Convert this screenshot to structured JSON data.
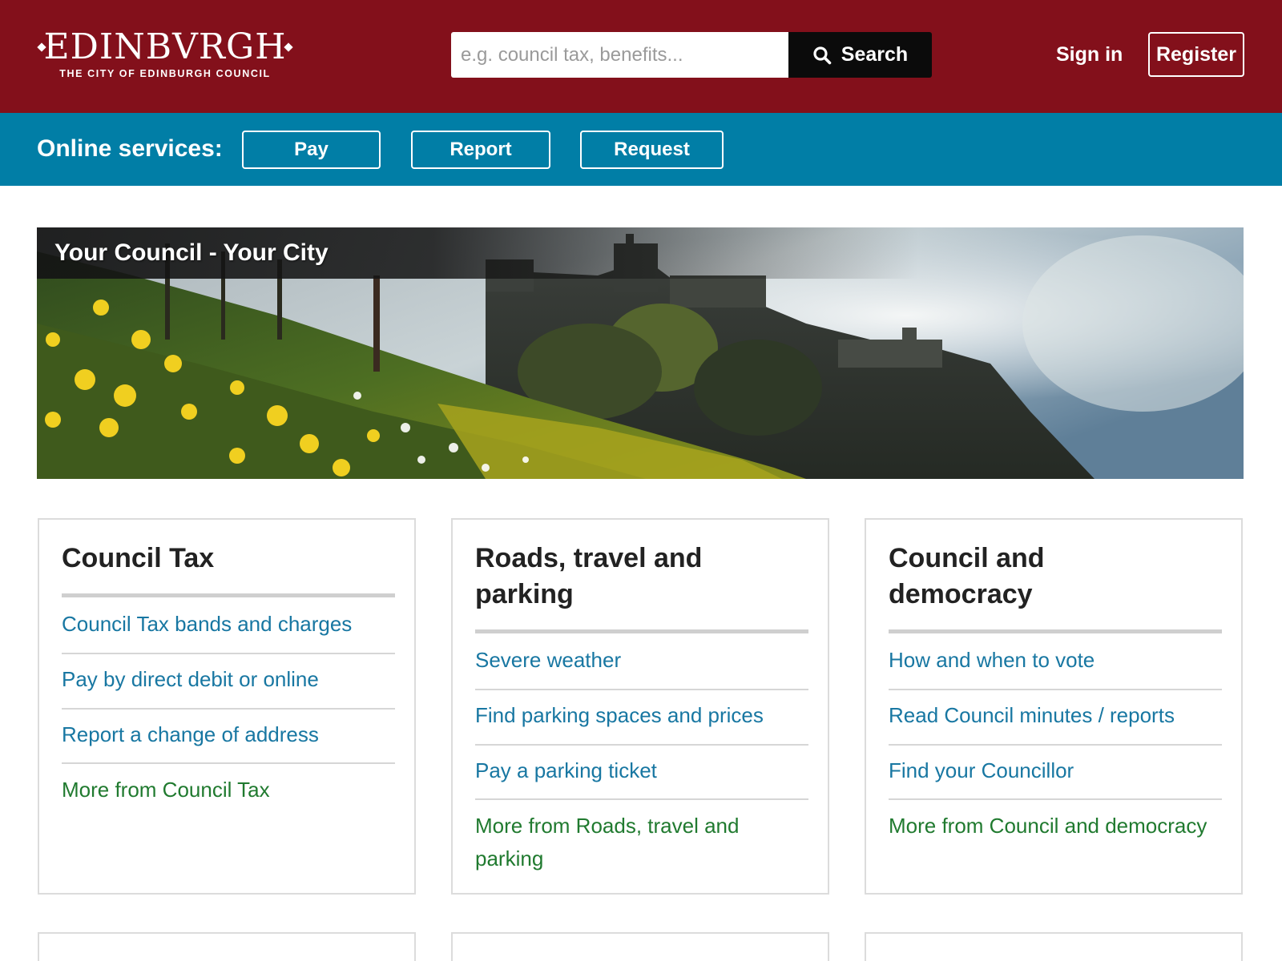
{
  "header": {
    "logo": {
      "name": "EDINBVRGH",
      "subtitle": "THE CITY OF EDINBURGH COUNCIL"
    },
    "search": {
      "placeholder": "e.g. council tax, benefits...",
      "value": "",
      "button_label": "Search",
      "button_icon": "search-icon"
    },
    "sign_in_label": "Sign in",
    "register_label": "Register"
  },
  "online_services": {
    "label": "Online services:",
    "buttons": [
      "Pay",
      "Report",
      "Request"
    ]
  },
  "hero": {
    "title": "Your Council - Your City"
  },
  "cards": [
    {
      "title": "Council Tax",
      "links": [
        "Council Tax bands and charges",
        "Pay by direct debit or online",
        "Report a change of address"
      ],
      "more": "More from Council Tax"
    },
    {
      "title": "Roads, travel and parking",
      "links": [
        "Severe weather",
        "Find parking spaces and prices",
        "Pay a parking ticket"
      ],
      "more": "More from Roads, travel and parking"
    },
    {
      "title": "Council and democracy",
      "links": [
        "How and when to vote",
        "Read Council minutes / reports",
        "Find your Councillor"
      ],
      "more": "More from Council and democracy"
    }
  ],
  "colors": {
    "header_bg": "#83101b",
    "services_bg": "#017ea6",
    "link": "#1877a2",
    "more_link": "#207a2f"
  }
}
